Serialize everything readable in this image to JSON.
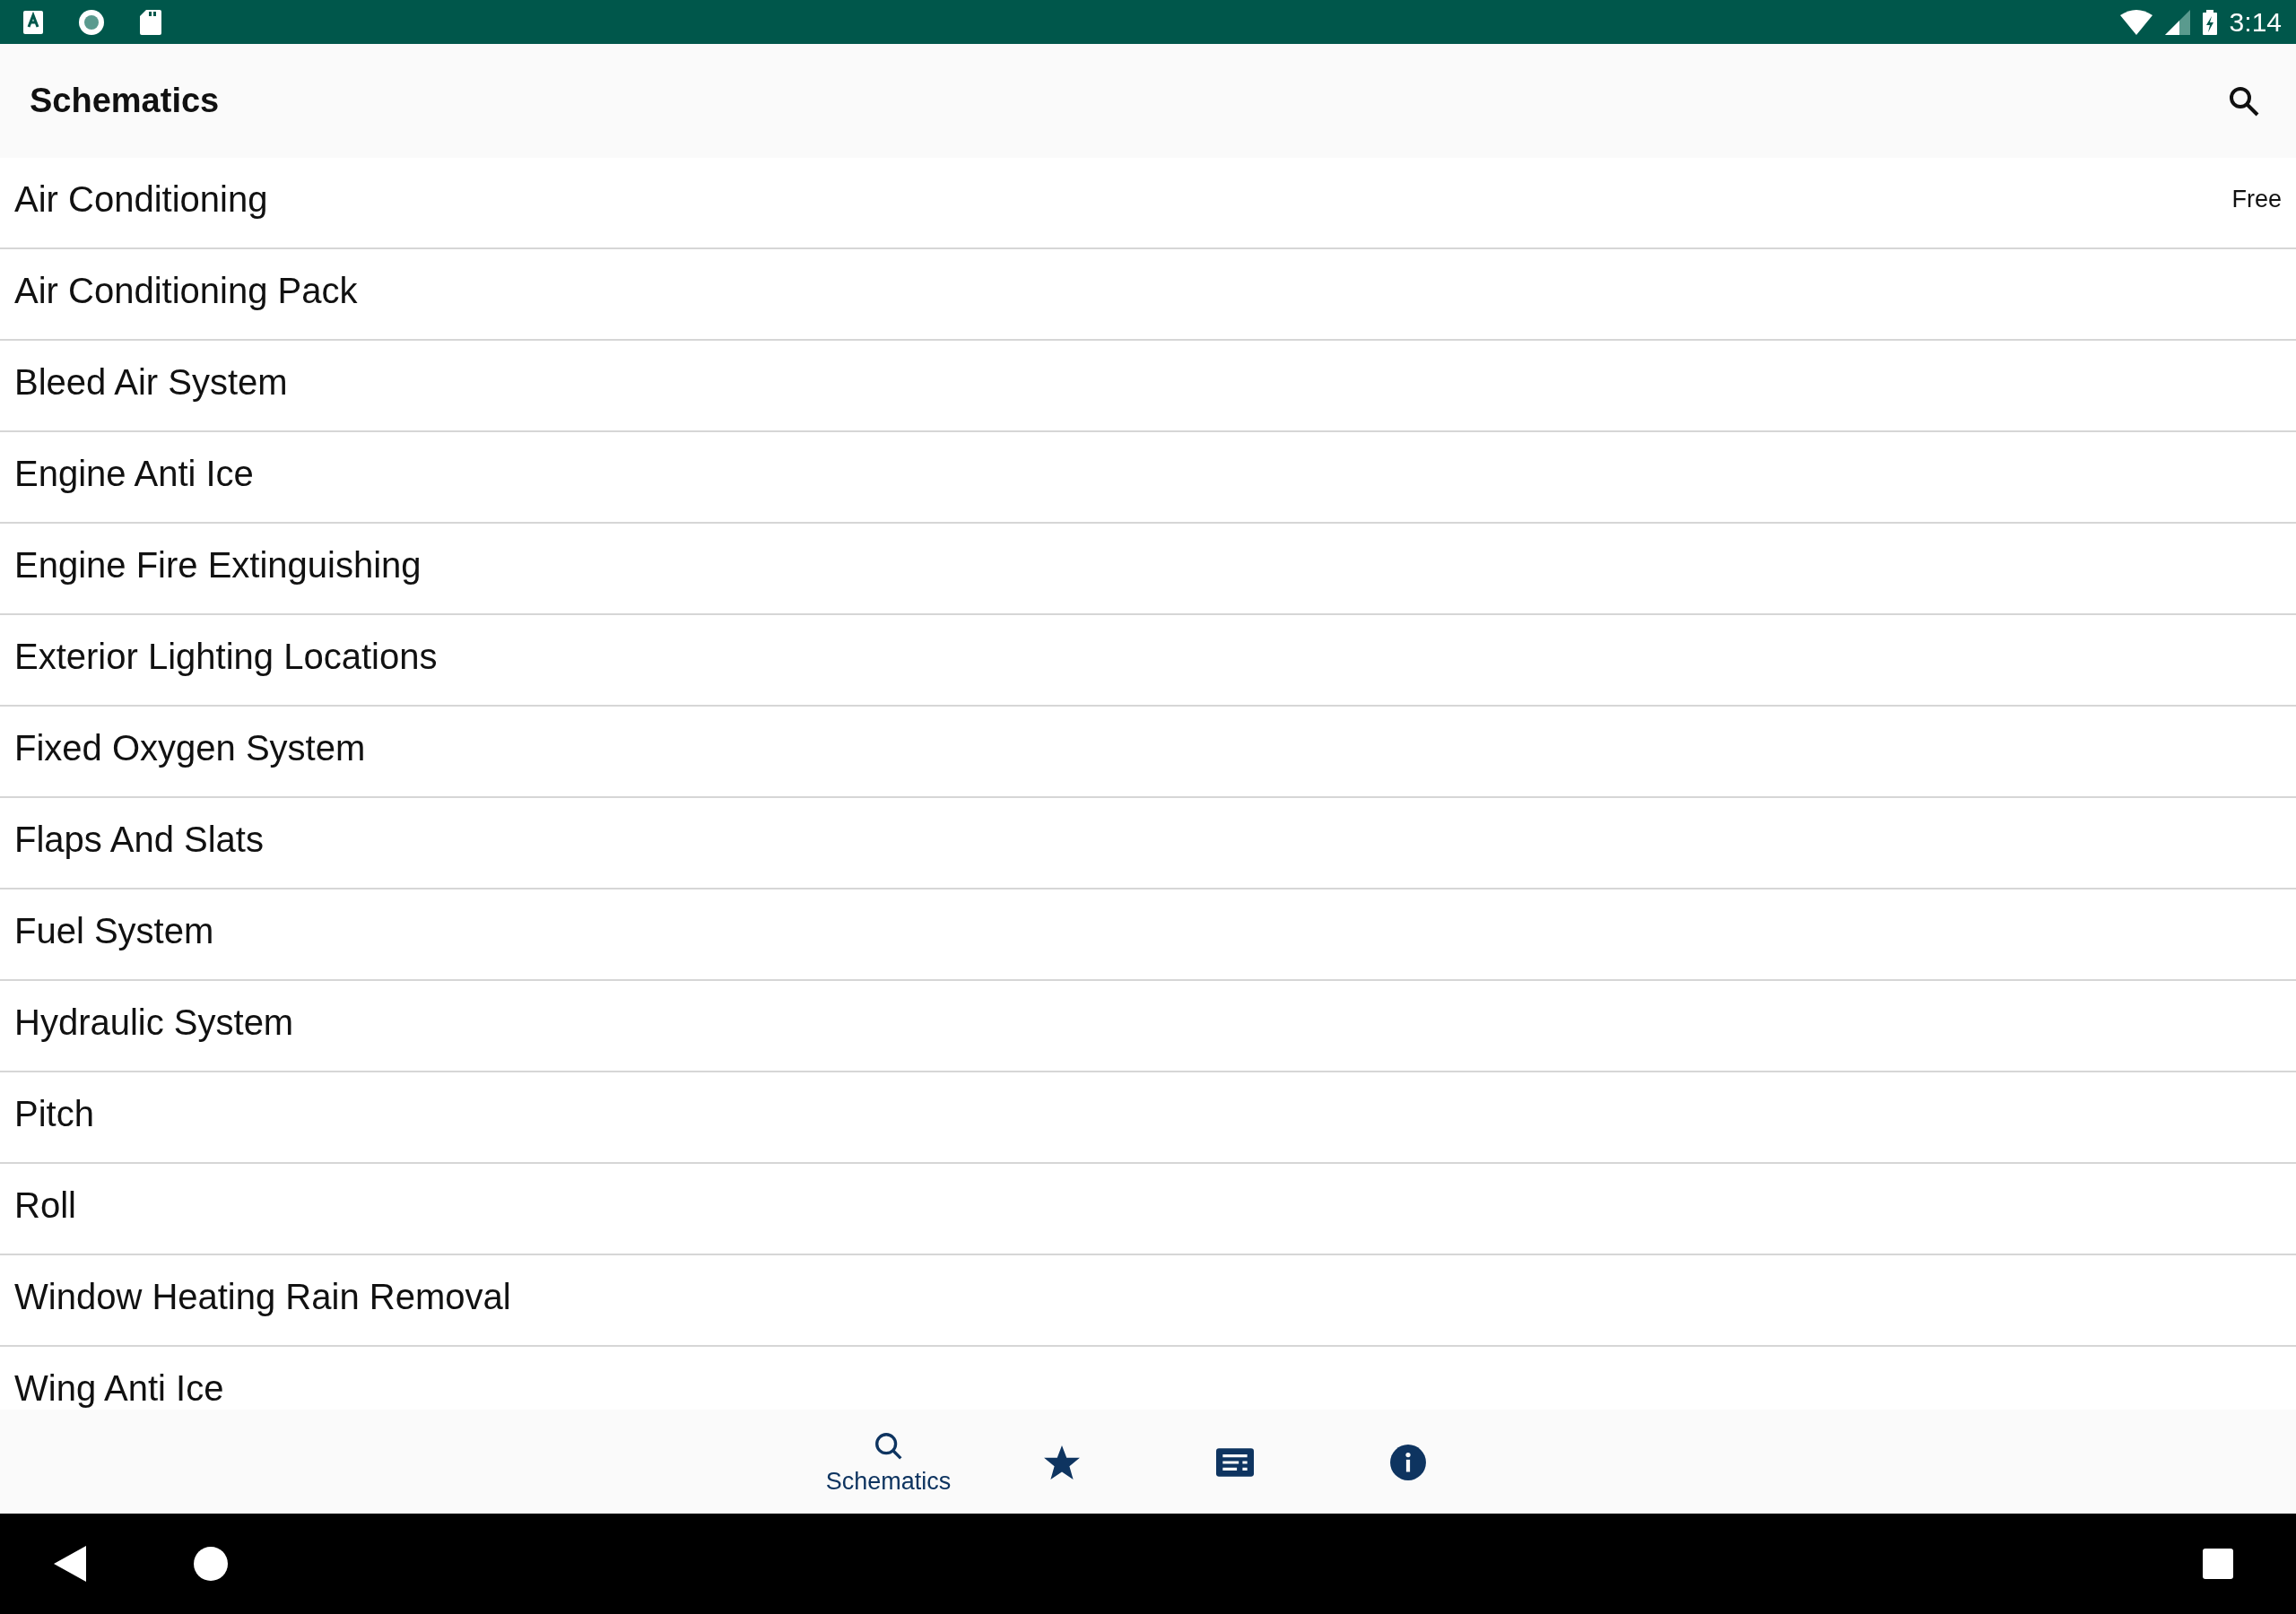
{
  "status_bar": {
    "time": "3:14"
  },
  "app_bar": {
    "title": "Schematics"
  },
  "items": [
    {
      "label": "Air Conditioning",
      "badge": "Free"
    },
    {
      "label": "Air Conditioning Pack"
    },
    {
      "label": "Bleed Air System"
    },
    {
      "label": "Engine Anti Ice"
    },
    {
      "label": "Engine Fire Extinguishing"
    },
    {
      "label": "Exterior Lighting Locations"
    },
    {
      "label": "Fixed Oxygen System"
    },
    {
      "label": "Flaps And Slats"
    },
    {
      "label": "Fuel System"
    },
    {
      "label": "Hydraulic System"
    },
    {
      "label": "Pitch"
    },
    {
      "label": "Roll"
    },
    {
      "label": "Window Heating Rain Removal"
    },
    {
      "label": "Wing Anti Ice"
    }
  ],
  "bottom_nav": [
    {
      "kind": "search",
      "label": "Schematics",
      "selected": true
    },
    {
      "kind": "star",
      "selected": false
    },
    {
      "kind": "notes",
      "selected": false
    },
    {
      "kind": "info",
      "selected": false
    }
  ]
}
